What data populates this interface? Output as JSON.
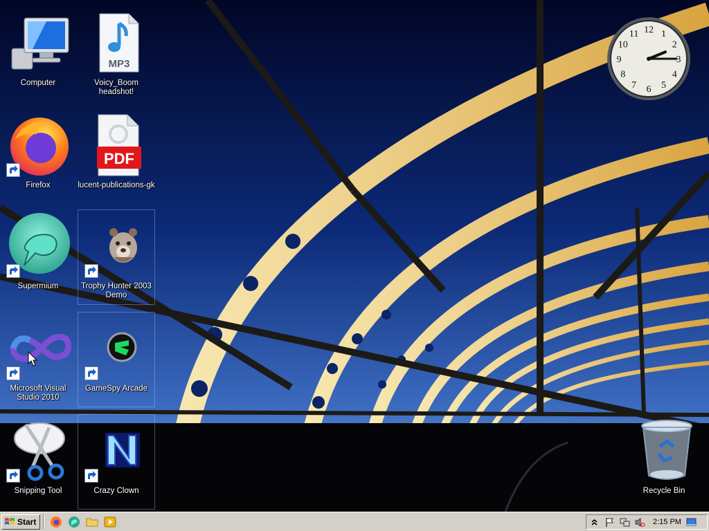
{
  "desktop": {
    "icons": [
      {
        "label": "Computer",
        "icon": "computer-icon"
      },
      {
        "label": "Voicy_Boom headshot!",
        "icon": "mp3-file-icon",
        "badge": "MP3"
      },
      {
        "label": "Firefox",
        "icon": "firefox-icon"
      },
      {
        "label": "lucent-publications-gk",
        "icon": "pdf-file-icon",
        "badge": "PDF"
      },
      {
        "label": "Supermium",
        "icon": "supermium-icon"
      },
      {
        "label": "Trophy Hunter 2003 Demo",
        "icon": "trophy-hunter-icon"
      },
      {
        "label": "Microsoft Visual Studio 2010",
        "icon": "visual-studio-icon"
      },
      {
        "label": "GameSpy Arcade",
        "icon": "gamespy-icon"
      },
      {
        "label": "Snipping Tool",
        "icon": "scissors-icon"
      },
      {
        "label": "Crazy Clown",
        "icon": "crazy-clown-icon"
      },
      {
        "label": "Recycle Bin",
        "icon": "recycle-bin-icon"
      }
    ]
  },
  "clock": {
    "hour": 2,
    "minute": 15,
    "numerals": [
      "12",
      "1",
      "2",
      "3",
      "4",
      "5",
      "6",
      "7",
      "8",
      "9",
      "10",
      "11"
    ]
  },
  "taskbar": {
    "start_label": "Start",
    "quick_launch": [
      "firefox-icon",
      "supermium-icon",
      "folder-icon",
      "media-player-icon"
    ],
    "tray_icons": [
      "chevron-up-icon",
      "flag-icon",
      "network-icon",
      "volume-muted-icon"
    ],
    "time": "2:15 PM",
    "show_desktop_icon": "show-desktop-icon"
  },
  "colors": {
    "taskbar": "#d4d0c8",
    "sky_top": "#020a3a",
    "sky_bottom": "#3e68b8",
    "bridge": "#e8c060"
  }
}
